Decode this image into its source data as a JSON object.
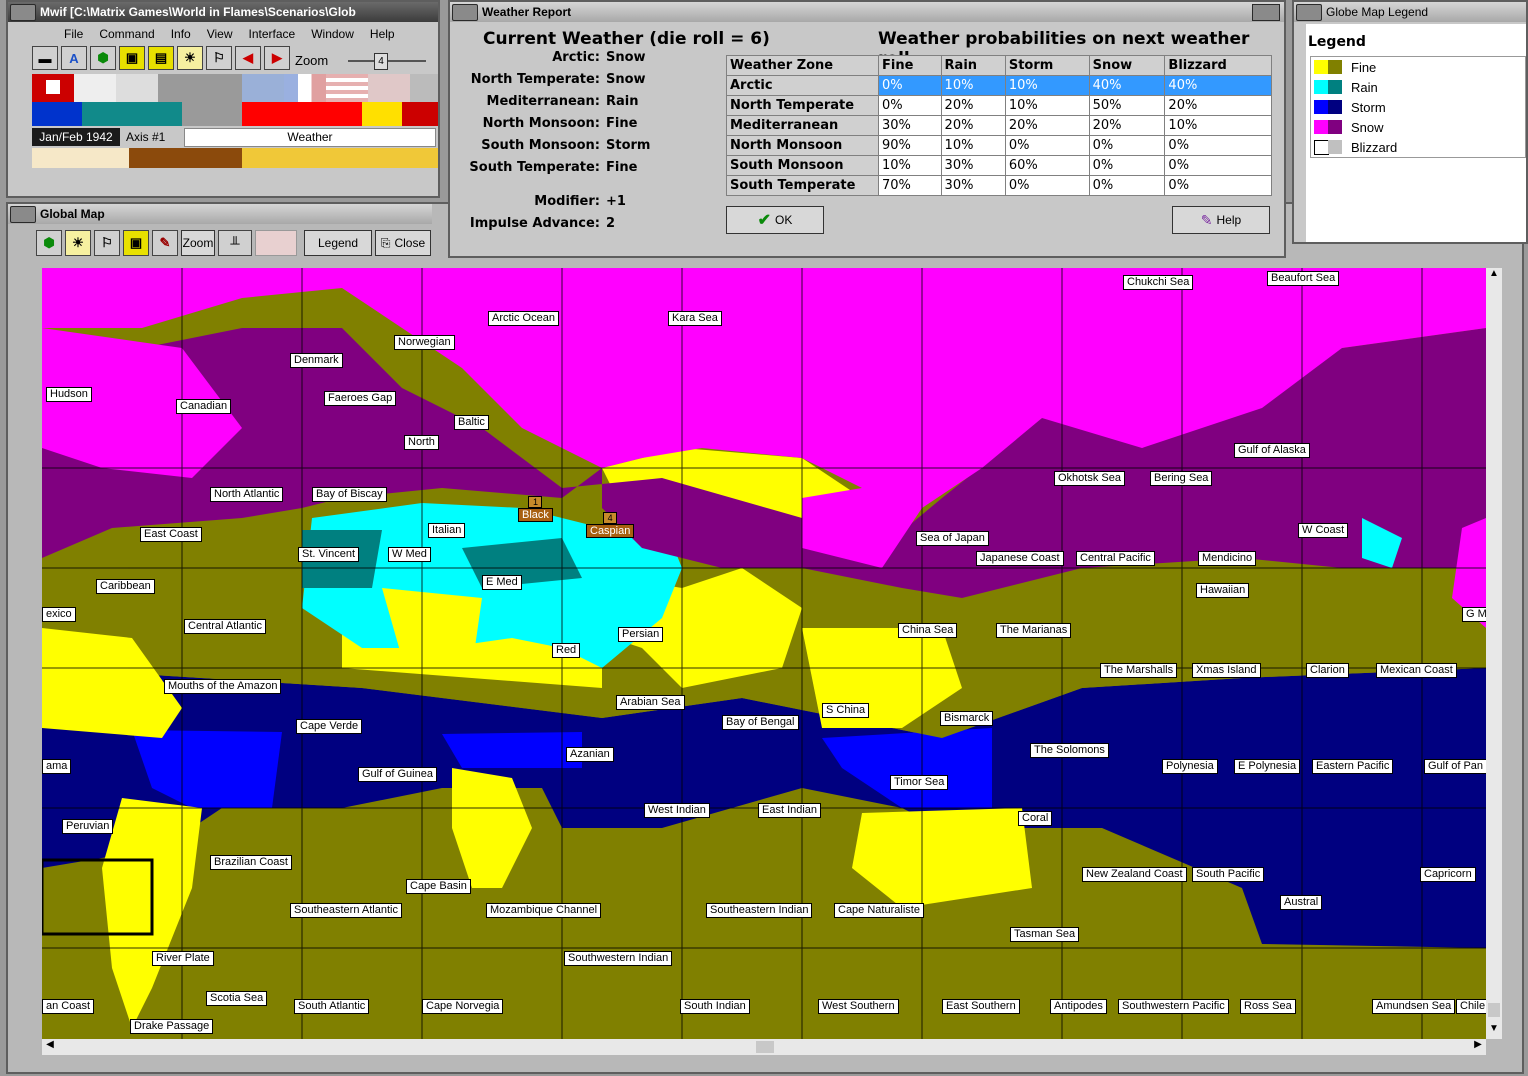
{
  "main_window": {
    "title": "Mwif [C:\\Matrix Games\\World in Flames\\Scenarios\\Glob",
    "menu": [
      "File",
      "Command",
      "Info",
      "View",
      "Interface",
      "Window",
      "Help"
    ],
    "zoom_label": "Zoom",
    "zoom_value": "4",
    "date": "Jan/Feb 1942",
    "axis_turn": "Axis #1",
    "phase": "Weather"
  },
  "global_map_window": {
    "title": "Global Map",
    "zoom_label": "Zoom",
    "legend_label": "Legend",
    "close_label": "Close"
  },
  "weather_report": {
    "title": "Weather Report",
    "heading_current": "Current Weather (die roll = 6)",
    "heading_probs": "Weather probabilities on next weather roll",
    "current": [
      {
        "zone": "Arctic:",
        "weather": "Snow"
      },
      {
        "zone": "North Temperate:",
        "weather": "Snow"
      },
      {
        "zone": "Mediterranean:",
        "weather": "Rain"
      },
      {
        "zone": "North Monsoon:",
        "weather": "Fine"
      },
      {
        "zone": "South Monsoon:",
        "weather": "Storm"
      },
      {
        "zone": "South Temperate:",
        "weather": "Fine"
      }
    ],
    "modifier_label": "Modifier:",
    "modifier_value": "+1",
    "impulse_label": "Impulse Advance:",
    "impulse_value": "2",
    "table_headers": [
      "Weather Zone",
      "Fine",
      "Rain",
      "Storm",
      "Snow",
      "Blizzard"
    ],
    "table_rows": [
      [
        "Arctic",
        "0%",
        "10%",
        "10%",
        "40%",
        "40%"
      ],
      [
        "North Temperate",
        "0%",
        "20%",
        "10%",
        "50%",
        "20%"
      ],
      [
        "Mediterranean",
        "30%",
        "20%",
        "20%",
        "20%",
        "10%"
      ],
      [
        "North Monsoon",
        "90%",
        "10%",
        "0%",
        "0%",
        "0%"
      ],
      [
        "South Monsoon",
        "10%",
        "30%",
        "60%",
        "0%",
        "0%"
      ],
      [
        "South Temperate",
        "70%",
        "30%",
        "0%",
        "0%",
        "0%"
      ]
    ],
    "ok_label": "OK",
    "help_label": "Help"
  },
  "legend_window": {
    "title": "Globe Map Legend",
    "heading": "Legend",
    "items": [
      {
        "label": "Fine",
        "c1": "#ffff00",
        "c2": "#808000"
      },
      {
        "label": "Rain",
        "c1": "#00ffff",
        "c2": "#008080"
      },
      {
        "label": "Storm",
        "c1": "#0000ff",
        "c2": "#000080"
      },
      {
        "label": "Snow",
        "c1": "#ff00ff",
        "c2": "#800080"
      },
      {
        "label": "Blizzard",
        "c1": "#ffffff",
        "c2": "#c0c0c0"
      }
    ]
  },
  "colors": {
    "fine": "#ffff00",
    "fine_dark": "#808000",
    "rain": "#00ffff",
    "rain_dark": "#008080",
    "storm": "#0000ff",
    "storm_dark": "#000080",
    "snow": "#ff00ff",
    "snow_dark": "#800080",
    "selection": "#3399ff"
  },
  "map_markers": [
    {
      "num": "1",
      "name": "Black"
    },
    {
      "num": "4",
      "name": "Caspian"
    }
  ],
  "map_labels": [
    "Chukchi Sea",
    "Beaufort Sea",
    "Arctic Ocean",
    "Kara Sea",
    "Norwegian",
    "Denmark",
    "Hudson",
    "Canadian",
    "Faeroes Gap",
    "Baltic",
    "North",
    "Gulf of Alaska",
    "North Atlantic",
    "Bay of Biscay",
    "Okhotsk Sea",
    "Bering Sea",
    "East Coast",
    "Italian",
    "W Coast",
    "St. Vincent",
    "W Med",
    "Sea of Japan",
    "Japanese Coast",
    "Central Pacific",
    "Mendicino",
    "Caribbean",
    "E Med",
    "Hawaiian",
    "exico",
    "Central Atlantic",
    "Persian",
    "China Sea",
    "The Marianas",
    "G M",
    "Red",
    "The Marshalls",
    "Xmas Island",
    "Clarion",
    "Mexican Coast",
    "Mouths of the Amazon",
    "Arabian Sea",
    "S China",
    "Cape Verde",
    "Bay of Bengal",
    "Bismarck",
    "The Solomons",
    "Azanian",
    "ama",
    "Gulf of Guinea",
    "Polynesia",
    "E Polynesia",
    "Eastern Pacific",
    "Gulf of Pan",
    "Timor Sea",
    "West Indian",
    "East Indian",
    "Peruvian",
    "Coral",
    "Brazilian Coast",
    "New Zealand Coast",
    "South Pacific",
    "Capricorn",
    "Cape Basin",
    "Austral",
    "Southeastern Atlantic",
    "Mozambique Channel",
    "Southeastern Indian",
    "Cape Naturaliste",
    "Tasman Sea",
    "River Plate",
    "Southwestern Indian",
    "Scotia Sea",
    "an Coast",
    "South Atlantic",
    "Cape Norvegia",
    "South Indian",
    "West Southern",
    "East Southern",
    "Antipodes",
    "Southwestern Pacific",
    "Ross Sea",
    "Amundsen Sea",
    "Chile",
    "Drake Passage"
  ]
}
